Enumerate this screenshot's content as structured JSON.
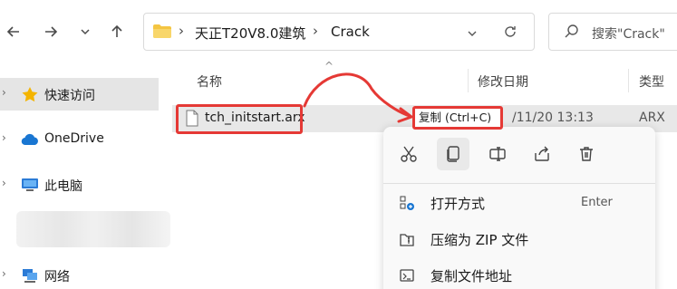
{
  "toolbar": {
    "back_icon": "arrow-left-icon",
    "forward_icon": "arrow-right-icon",
    "recent_icon": "chevron-down-icon",
    "up_icon": "arrow-up-icon",
    "breadcrumb": [
      "天正T20V8.0建筑",
      "Crack"
    ],
    "search_placeholder": "搜索\"Crack\""
  },
  "sidebar": {
    "items": [
      {
        "label": "快速访问",
        "icon": "star-icon"
      },
      {
        "label": "OneDrive",
        "icon": "cloud-icon"
      },
      {
        "label": "此电脑",
        "icon": "computer-icon"
      },
      {
        "label": "网络",
        "icon": "network-icon"
      }
    ]
  },
  "columns": {
    "name": "名称",
    "date": "修改日期",
    "type": "类型"
  },
  "file": {
    "name": "tch_initstart.arx",
    "date": "/11/20 13:13",
    "type": "ARX 文"
  },
  "tooltip": "复制 (Ctrl+C)",
  "context_menu": {
    "icons": [
      "cut-icon",
      "copy-icon",
      "rename-icon",
      "share-icon",
      "delete-icon"
    ],
    "items": [
      {
        "label": "打开方式",
        "shortcut": "Enter",
        "icon": "open-with-icon"
      },
      {
        "label": "压缩为 ZIP 文件",
        "shortcut": "",
        "icon": "zip-icon"
      },
      {
        "label": "复制文件地址",
        "shortcut": "",
        "icon": "copy-path-icon"
      }
    ]
  },
  "colors": {
    "highlight_red": "#e53935",
    "selected_row": "#e8e8e8",
    "folder_yellow": "#f4c542",
    "accent_blue": "#1976d2"
  }
}
